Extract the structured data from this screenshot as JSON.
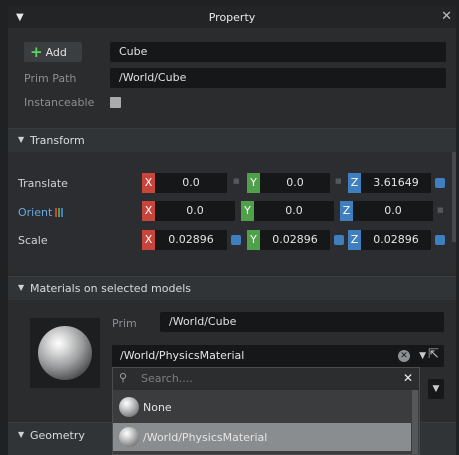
{
  "window": {
    "title": "Property"
  },
  "header": {
    "add_label": "Add",
    "name_value": "Cube",
    "prim_path_label": "Prim Path",
    "prim_path_value": "/World/Cube",
    "instanceable_label": "Instanceable"
  },
  "transform": {
    "section_title": "Transform",
    "translate": {
      "label": "Translate",
      "x": "0.0",
      "y": "0.0",
      "z": "3.61649"
    },
    "orient": {
      "label": "Orient",
      "x": "0.0",
      "y": "0.0",
      "z": "0.0"
    },
    "scale": {
      "label": "Scale",
      "x": "0.02896",
      "y": "0.02896",
      "z": "0.02896"
    },
    "axes": {
      "x": "X",
      "y": "Y",
      "z": "Z"
    }
  },
  "materials": {
    "section_title": "Materials on selected models",
    "prim_label": "Prim",
    "prim_value": "/World/Cube",
    "selected_material": "/World/PhysicsMaterial",
    "search_placeholder": "Search....",
    "options": [
      "None",
      "/World/PhysicsMaterial"
    ]
  },
  "geometry": {
    "section_title": "Geometry"
  },
  "colors": {
    "axis_x": "#c8453b",
    "axis_y": "#4fa04a",
    "axis_z": "#3f7fc0",
    "add_plus": "#5fd45f"
  }
}
